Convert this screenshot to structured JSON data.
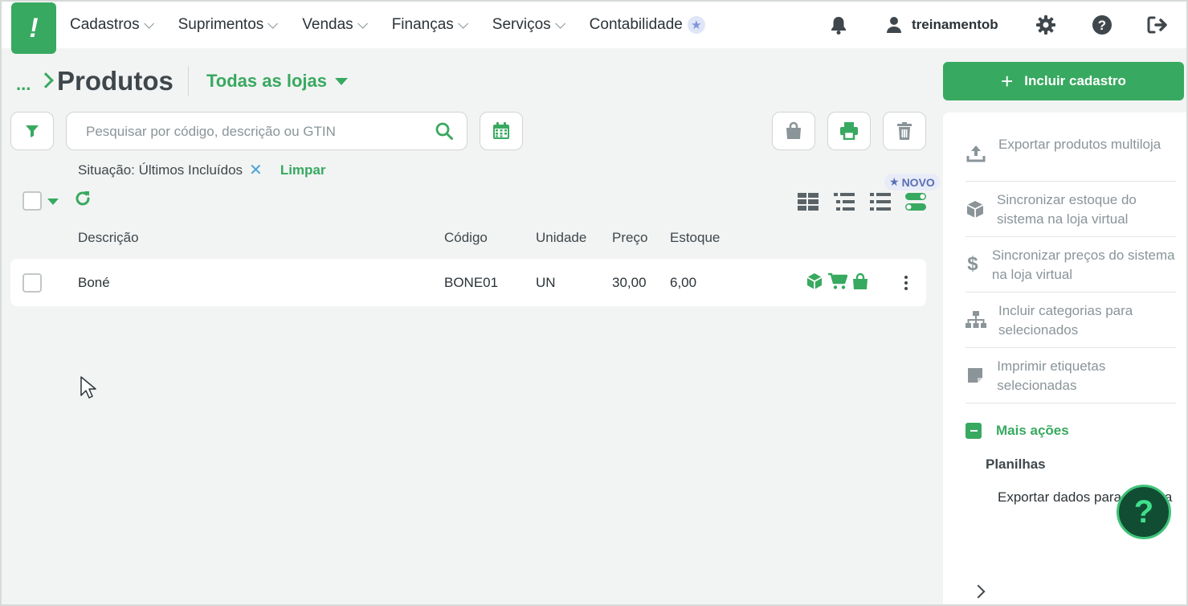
{
  "nav": {
    "logo_glyph": "!",
    "items": [
      {
        "label": "Cadastros"
      },
      {
        "label": "Suprimentos"
      },
      {
        "label": "Vendas"
      },
      {
        "label": "Finanças"
      },
      {
        "label": "Serviços"
      },
      {
        "label": "Contabilidade"
      }
    ],
    "user": "treinamentob"
  },
  "header": {
    "breadcrumb_dots": "...",
    "title": "Produtos",
    "store_selector": "Todas as lojas",
    "primary_button": "Incluir cadastro"
  },
  "search": {
    "placeholder": "Pesquisar por código, descrição ou GTIN",
    "value": ""
  },
  "filter_chip": {
    "label": "Situação: Últimos Incluídos",
    "clear_label": "Limpar"
  },
  "badge_new": "NOVO",
  "table": {
    "columns": [
      "Descrição",
      "Código",
      "Unidade",
      "Preço",
      "Estoque"
    ],
    "rows": [
      {
        "descricao": "Boné",
        "codigo": "BONE01",
        "unidade": "UN",
        "preco": "30,00",
        "estoque": "6,00"
      }
    ]
  },
  "side_panel": {
    "items": [
      {
        "label": "Exportar produtos multiloja",
        "icon": "upload-icon"
      },
      {
        "label": "Sincronizar estoque do sistema na loja virtual",
        "icon": "box-icon"
      },
      {
        "label": "Sincronizar preços do sistema na loja virtual",
        "icon": "dollar-icon"
      },
      {
        "label": "Incluir categorias para selecionados",
        "icon": "hierarchy-icon"
      },
      {
        "label": "Imprimir etiquetas selecionadas",
        "icon": "sticky-note-icon"
      }
    ],
    "more_actions": "Mais ações",
    "group_title": "Planilhas",
    "group_item": "Exportar dados para planilha"
  },
  "help_fab": "?",
  "colors": {
    "brand": "#38a960",
    "text": "#2b3338",
    "muted": "#8a9499",
    "background": "#f2f4f3"
  }
}
